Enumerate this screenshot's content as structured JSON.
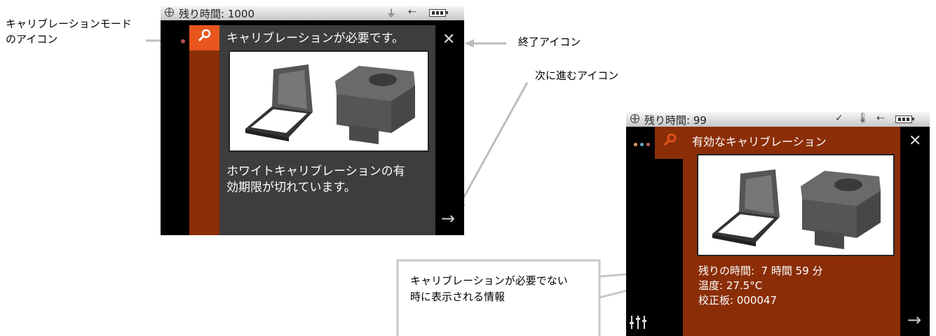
{
  "callouts": {
    "mode_icon_line1": "キャリブレーションモード",
    "mode_icon_line2": "のアイコン",
    "exit_icon": "終了アイコン",
    "next_icon": "次に進むアイコン",
    "info_line1": "キャリブレーションが必要でない",
    "info_line2": "時に表示される情報"
  },
  "screen1": {
    "status_text": "残り時間: 1000",
    "title": "キャリブレーションが必要です。",
    "message_line1": "ホワイトキャリブレーションの有",
    "message_line2": "効期限が切れています。",
    "close_label": "✕",
    "next_label": "→"
  },
  "screen2": {
    "status_text": "残り時間: 99",
    "title": "有効なキャリブレーション",
    "info_line1": "残りの時間:  7 時間 59 分",
    "info_line2": "温度: 27.5°C",
    "info_line3": "校正板: 000047",
    "close_label": "✕",
    "next_label": "→"
  },
  "colors": {
    "mode_orange": "#e8561e",
    "panel_rust": "#8b2e08",
    "content_gray": "#3d3d3d"
  }
}
